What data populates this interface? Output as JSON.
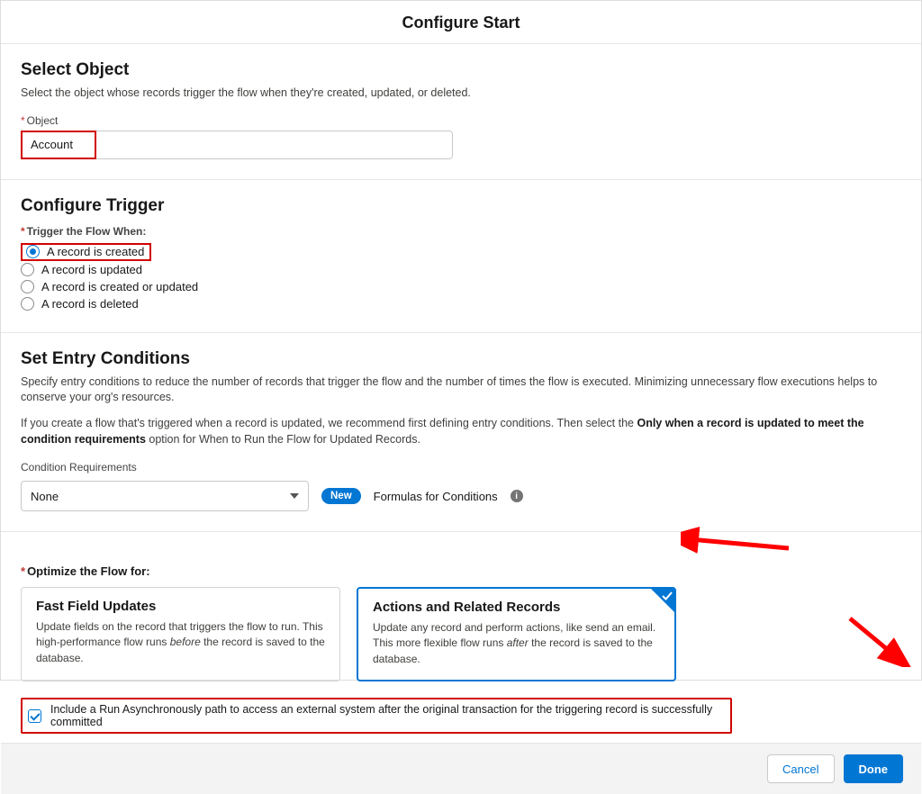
{
  "modal": {
    "title": "Configure Start"
  },
  "selectObject": {
    "heading": "Select Object",
    "help": "Select the object whose records trigger the flow when they're created, updated, or deleted.",
    "label": "Object",
    "value": "Account"
  },
  "configureTrigger": {
    "heading": "Configure Trigger",
    "label": "Trigger the Flow When:",
    "options": [
      {
        "label": "A record is created",
        "checked": true
      },
      {
        "label": "A record is updated",
        "checked": false
      },
      {
        "label": "A record is created or updated",
        "checked": false
      },
      {
        "label": "A record is deleted",
        "checked": false
      }
    ]
  },
  "entryConditions": {
    "heading": "Set Entry Conditions",
    "help": "Specify entry conditions to reduce the number of records that trigger the flow and the number of times the flow is executed. Minimizing unnecessary flow executions helps to conserve your org's resources.",
    "para2_pre": "If you create a flow that's triggered when a record is updated, we recommend first defining entry conditions. Then select the ",
    "para2_bold": "Only when a record is updated to meet the condition requirements",
    "para2_post": " option for When to Run the Flow for Updated Records.",
    "reqLabel": "Condition Requirements",
    "reqValue": "None",
    "newPill": "New",
    "formulasText": "Formulas for Conditions"
  },
  "optimize": {
    "label": "Optimize the Flow for:",
    "cards": [
      {
        "title": "Fast Field Updates",
        "desc_pre": "Update fields on the record that triggers the flow to run. This high-performance flow runs ",
        "desc_em": "before",
        "desc_post": " the record is saved to the database.",
        "selected": false
      },
      {
        "title": "Actions and Related Records",
        "desc_pre": "Update any record and perform actions, like send an email. This more flexible flow runs ",
        "desc_em": "after",
        "desc_post": " the record is saved to the database.",
        "selected": true
      }
    ],
    "asyncLabel": "Include a Run Asynchronously path to access an external system after the original transaction for the triggering record is successfully committed"
  },
  "footer": {
    "cancel": "Cancel",
    "done": "Done"
  }
}
